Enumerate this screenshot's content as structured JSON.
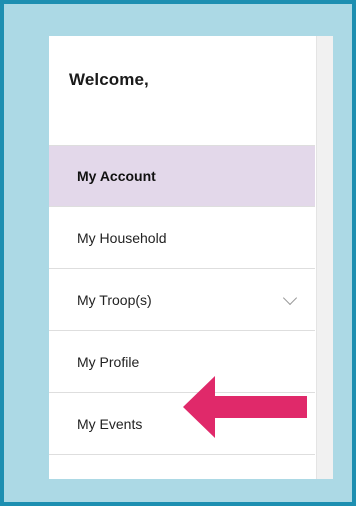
{
  "sidebar": {
    "welcome": "Welcome,",
    "items": [
      {
        "label": "My Account",
        "active": true
      },
      {
        "label": "My Household",
        "active": false
      },
      {
        "label": "My Troop(s)",
        "active": false,
        "expandable": true,
        "icon": "chevron-down-icon"
      },
      {
        "label": "My Profile",
        "active": false
      },
      {
        "label": "My Events",
        "active": false
      }
    ]
  },
  "annotation": {
    "arrow_color": "#e0296a",
    "arrow_icon": "left-arrow-icon"
  },
  "colors": {
    "frame_border": "#1d8fb1",
    "frame_background": "#acd9e5",
    "active_item_background": "#e3d8ea"
  }
}
